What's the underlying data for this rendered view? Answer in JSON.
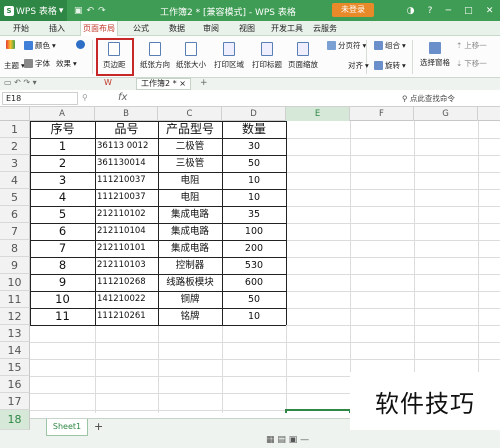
{
  "app": {
    "logo_text": "WPS 表格",
    "doc_title": "工作簿2 * [兼容模式] - WPS 表格",
    "login_label": "未登录"
  },
  "menu": {
    "tabs": [
      "开始",
      "插入",
      "页面布局",
      "公式",
      "数据",
      "审阅",
      "视图",
      "开发工具",
      "云服务"
    ],
    "active": "页面布局"
  },
  "ribbon": {
    "theme": "主题",
    "color": "颜色",
    "font": "字体",
    "effect": "效果",
    "margins": "页边距",
    "orientation": "纸张方向",
    "size": "纸张大小",
    "print_area": "打印区域",
    "print_titles": "打印标题",
    "page_zoom": "页面缩放",
    "break": "分页符",
    "combine": "组合",
    "align": "对齐",
    "rotate": "旋转",
    "pane": "选择窗格",
    "up": "上移一",
    "down": "下移一"
  },
  "document_tab": {
    "label": "工作簿2 *"
  },
  "formula_bar": {
    "name_box": "E18",
    "fx": "fx",
    "search_placeholder": "点此查找命令"
  },
  "columns": [
    "A",
    "B",
    "C",
    "D",
    "E",
    "F",
    "G"
  ],
  "rows": [
    "1",
    "2",
    "3",
    "4",
    "5",
    "6",
    "7",
    "8",
    "9",
    "10",
    "11",
    "12",
    "13",
    "14",
    "15",
    "16",
    "17",
    "18"
  ],
  "table": {
    "headers": [
      "序号",
      "品号",
      "产品型号",
      "数量"
    ],
    "data": [
      [
        "1",
        "36113    0012",
        "二极管",
        "30"
      ],
      [
        "2",
        "361130014",
        "三极管",
        "50"
      ],
      [
        "3",
        "111210037",
        "电阻",
        "10"
      ],
      [
        "4",
        "111210037",
        "电阻",
        "10"
      ],
      [
        "5",
        "212110102",
        "集成电路",
        "35"
      ],
      [
        "6",
        "212110104",
        "集成电路",
        "100"
      ],
      [
        "7",
        "212110101",
        "集成电路",
        "200"
      ],
      [
        "8",
        "212110103",
        "控制器",
        "530"
      ],
      [
        "9",
        "111210268",
        "线路板模块",
        "600"
      ],
      [
        "10",
        "141210022",
        "铜牌",
        "50"
      ],
      [
        "11",
        "111210261",
        "铭牌",
        "10"
      ]
    ]
  },
  "sheet": {
    "tab": "Sheet1",
    "add": "+"
  },
  "watermark": "软件技巧"
}
